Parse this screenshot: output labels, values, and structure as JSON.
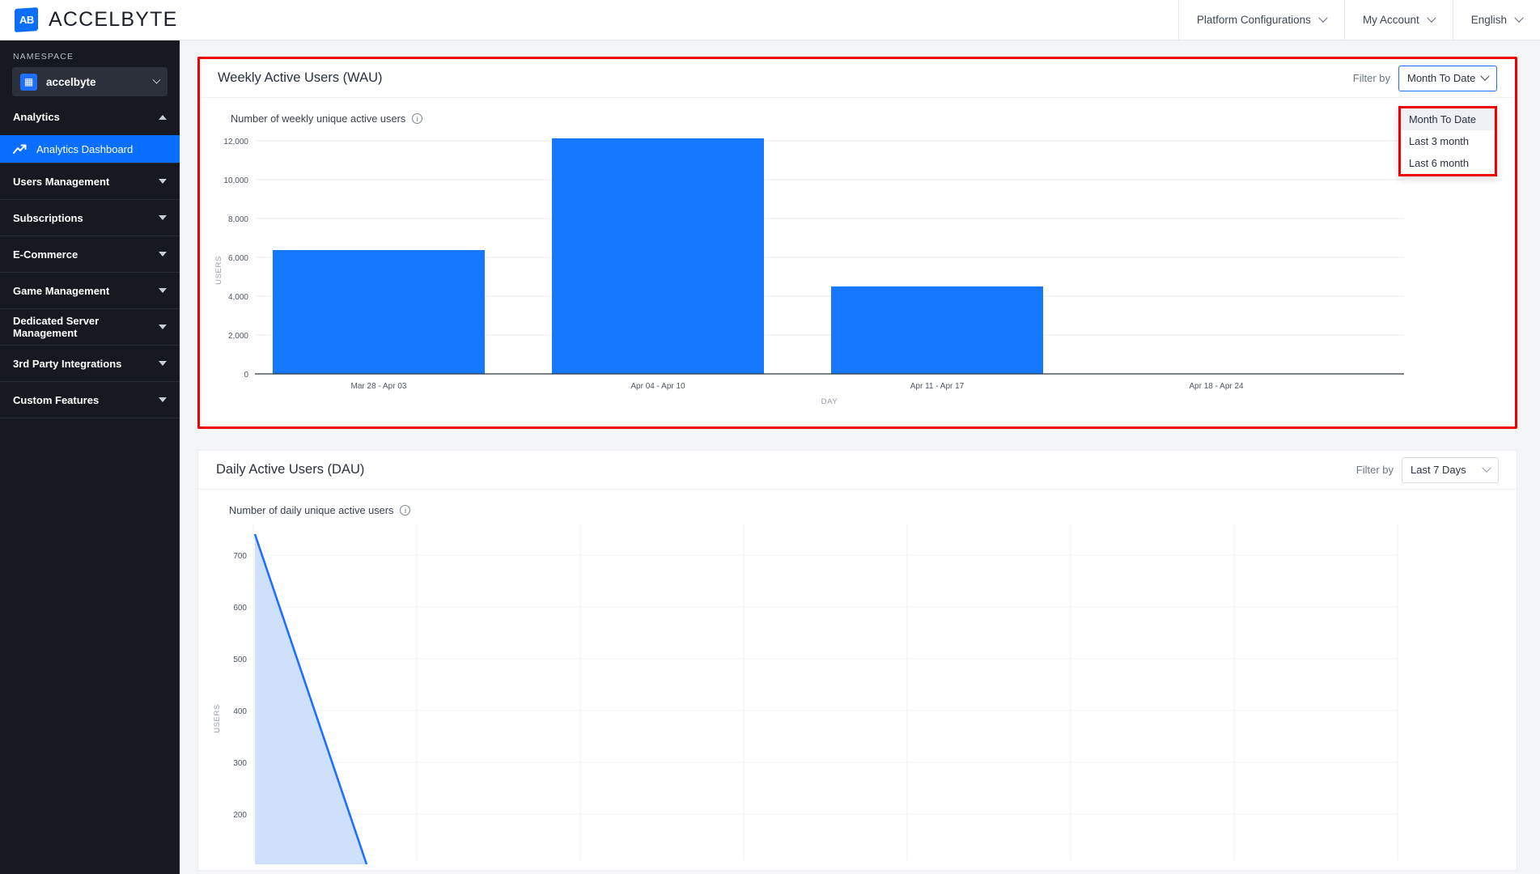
{
  "header": {
    "brand_name": "ACCELBYTE",
    "logo_text": "AB",
    "nav": [
      {
        "label": "Platform Configurations",
        "icon": "chevron-down-icon"
      },
      {
        "label": "My Account",
        "icon": "chevron-down-icon"
      },
      {
        "label": "English",
        "icon": "chevron-down-icon"
      }
    ]
  },
  "sidebar": {
    "namespace_label": "NAMESPACE",
    "namespace_value": "accelbyte",
    "namespace_icon": "building-icon",
    "section_title": "Analytics",
    "active_item": {
      "label": "Analytics Dashboard",
      "icon": "trend-up-icon"
    },
    "items": [
      {
        "label": "Users Management"
      },
      {
        "label": "Subscriptions"
      },
      {
        "label": "E-Commerce"
      },
      {
        "label": "Game Management"
      },
      {
        "label": "Dedicated Server Management"
      },
      {
        "label": "3rd Party Integrations"
      },
      {
        "label": "Custom Features"
      }
    ]
  },
  "wau_card": {
    "title": "Weekly Active Users (WAU)",
    "filter_label": "Filter by",
    "filter_value": "Month To Date",
    "subtitle": "Number of weekly unique active users",
    "info_icon": "info-icon",
    "dropdown_open": true,
    "dropdown_options": [
      "Month To Date",
      "Last 3 month",
      "Last 6 month"
    ],
    "dropdown_selected": "Month To Date"
  },
  "dau_card": {
    "title": "Daily Active Users (DAU)",
    "filter_label": "Filter by",
    "filter_value": "Last 7 Days",
    "subtitle": "Number of daily unique active users",
    "info_icon": "info-icon"
  },
  "colors": {
    "accent": "#0a6fff",
    "bar": "#1677ff",
    "highlight": "#ee0000",
    "sidebar_bg": "#16191f",
    "page_bg": "#f4f5f7"
  },
  "chart_data": [
    {
      "id": "wau",
      "type": "bar",
      "title": "Number of weekly unique active users",
      "xlabel": "DAY",
      "ylabel": "USERS",
      "categories": [
        "Mar 28 - Apr 03",
        "Apr 04 - Apr 10",
        "Apr 11 - Apr 17",
        "Apr 18 - Apr 24"
      ],
      "values": [
        6450,
        12150,
        4550,
        0
      ],
      "ylim": [
        0,
        13000
      ],
      "yticks": [
        0,
        2000,
        4000,
        6000,
        8000,
        10000,
        12000
      ],
      "ytick_labels": [
        "0",
        "2,000",
        "4,000",
        "6,000",
        "8,000",
        "10,000",
        "12,000"
      ],
      "grid": true,
      "legend": false,
      "bar_color": "#1677ff"
    },
    {
      "id": "dau",
      "type": "area",
      "title": "Number of daily unique active users",
      "xlabel": "",
      "ylabel": "USERS",
      "x": [
        0,
        1
      ],
      "values": [
        740,
        0
      ],
      "ylim": [
        0,
        760
      ],
      "yticks": [
        200,
        300,
        400,
        500,
        600,
        700
      ],
      "ytick_labels": [
        "200",
        "300",
        "400",
        "500",
        "600",
        "700"
      ],
      "grid": true,
      "legend": false,
      "line_color": "#1f6fff",
      "fill_color": "#cfe0fd"
    }
  ]
}
